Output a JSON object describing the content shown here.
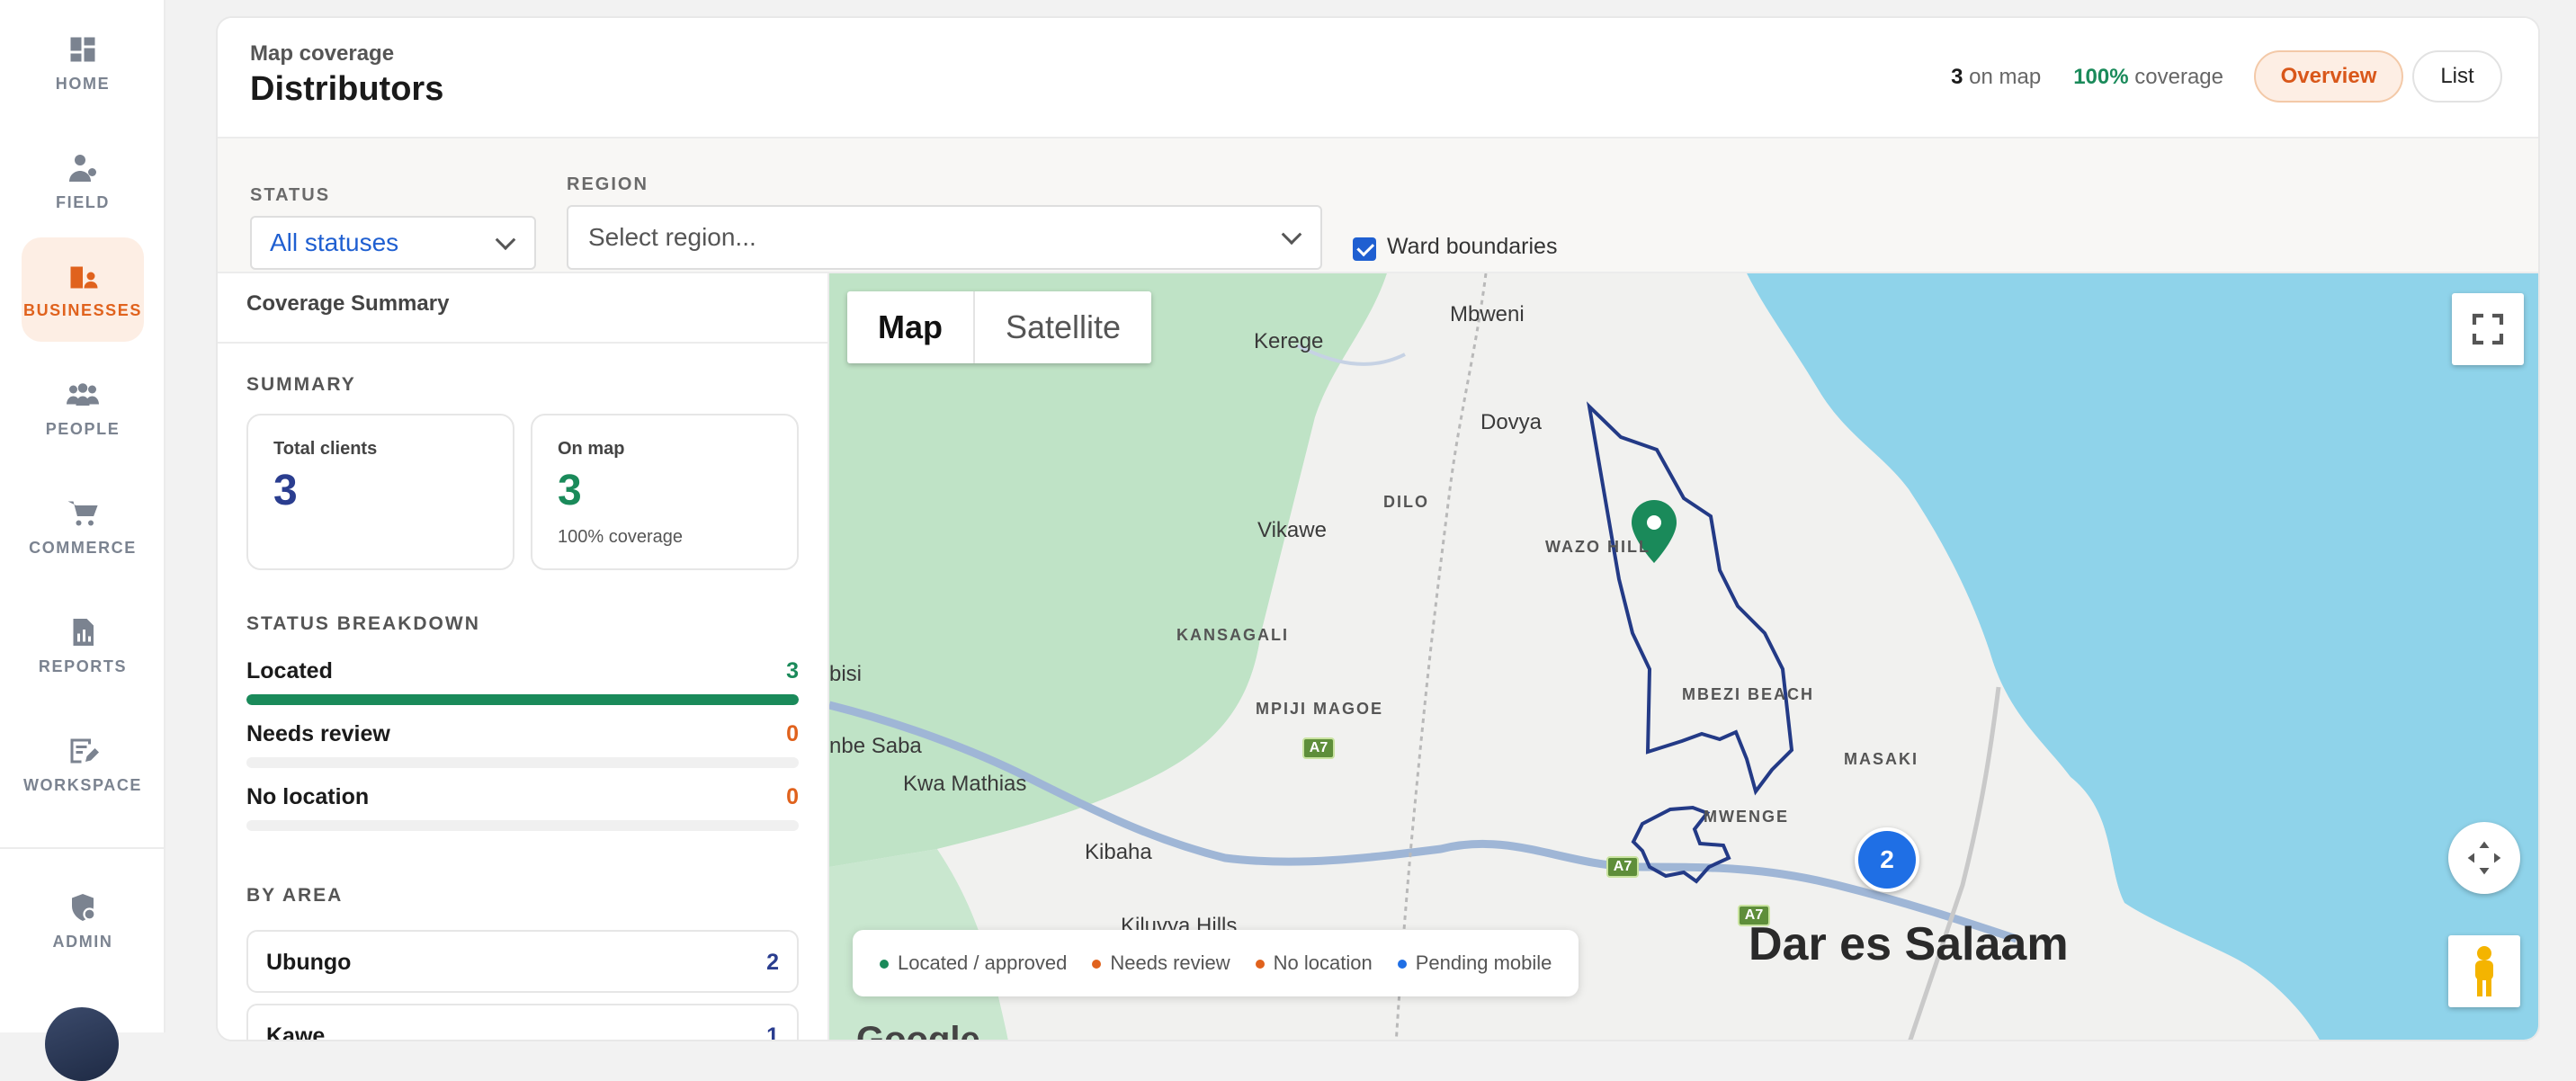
{
  "sidebar": {
    "items": [
      {
        "label": "HOME",
        "icon": "grid-icon",
        "active": false
      },
      {
        "label": "FIELD",
        "icon": "field-agent-icon",
        "active": false
      },
      {
        "label": "BUSINESSES",
        "icon": "building-icon",
        "active": true
      },
      {
        "label": "PEOPLE",
        "icon": "people-icon",
        "active": false
      },
      {
        "label": "COMMERCE",
        "icon": "cart-icon",
        "active": false
      },
      {
        "label": "REPORTS",
        "icon": "report-icon",
        "active": false
      },
      {
        "label": "WORKSPACE",
        "icon": "workspace-icon",
        "active": false
      }
    ],
    "admin": {
      "label": "ADMIN",
      "icon": "admin-shield-icon"
    }
  },
  "header": {
    "kicker": "Map coverage",
    "title": "Distributors",
    "on_map_count": "3",
    "on_map_text": "on map",
    "coverage_value": "100%",
    "coverage_text": "coverage",
    "overview_label": "Overview",
    "list_label": "List"
  },
  "filters": {
    "status_label": "STATUS",
    "status_value": "All statuses",
    "region_label": "REGION",
    "region_placeholder": "Select region...",
    "ward_boundaries_label": "Ward boundaries",
    "ward_boundaries_checked": true
  },
  "panel": {
    "title": "Coverage Summary",
    "summary_label": "SUMMARY",
    "total_clients_label": "Total clients",
    "total_clients_value": "3",
    "on_map_label": "On map",
    "on_map_value": "3",
    "on_map_sub": "100% coverage",
    "status_breakdown_label": "STATUS BREAKDOWN",
    "breakdown": [
      {
        "label": "Located",
        "value": "3",
        "fraction": 1.0,
        "color": "#1a8a5a"
      },
      {
        "label": "Needs review",
        "value": "0",
        "fraction": 0,
        "color": "#e0621d"
      },
      {
        "label": "No location",
        "value": "0",
        "fraction": 0,
        "color": "#e0621d"
      }
    ],
    "by_area_label": "BY AREA",
    "areas": [
      {
        "label": "Ubungo",
        "value": "2"
      },
      {
        "label": "Kawe",
        "value": "1"
      }
    ]
  },
  "map": {
    "type_map": "Map",
    "type_satellite": "Satellite",
    "labels": {
      "mbweni": "Mbweni",
      "kerege": "Kerege",
      "dovya": "Dovya",
      "dilo": "DILO",
      "vikawe": "Vikawe",
      "wazo_hill": "WAZO HILL",
      "kansagali": "KANSAGALI",
      "mpiji_magoe": "MPIJI MAGOE",
      "mbezi_beach": "MBEZI BEACH",
      "masaki": "MASAKI",
      "bisi": "bisi",
      "nbe_saba": "nbe Saba",
      "kwa_mathias": "Kwa Mathias",
      "kibaha": "Kibaha",
      "mwenge": "MWENGE",
      "kiluvya_hills": "Kiluvya Hills",
      "dar_es_salaam": "Dar es Salaam",
      "google": "Google"
    },
    "road_a7": "A7",
    "cluster_count": "2",
    "legend": [
      {
        "label": "Located / approved",
        "color": "#1a8a5a"
      },
      {
        "label": "Needs review",
        "color": "#e0621d"
      },
      {
        "label": "No location",
        "color": "#e0621d"
      },
      {
        "label": "Pending mobile",
        "color": "#1f6fe5"
      }
    ]
  }
}
